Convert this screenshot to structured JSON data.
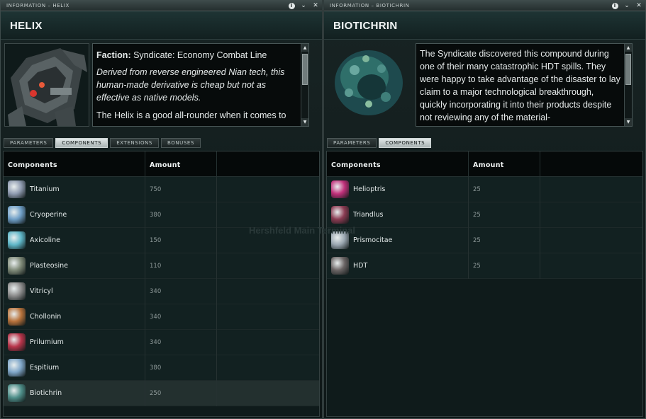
{
  "left": {
    "title": "INFORMATION – HELIX",
    "name": "HELIX",
    "faction_label": "Faction:",
    "faction_value": " Syndicate: Economy Combat Line",
    "description": "Derived from reverse engineered Nian tech, this human-made derivative is cheap but not as effective as native models.",
    "description2": "The Helix is a good all-rounder when it comes to",
    "tabs": [
      "PARAMETERS",
      "COMPONENTS",
      "EXTENSIONS",
      "BONUSES"
    ],
    "columns": [
      "Components",
      "Amount"
    ],
    "rows": [
      {
        "name": "Titanium",
        "amount": "750",
        "icon": "titanium-icon",
        "color": "#8f9bb0"
      },
      {
        "name": "Cryoperine",
        "amount": "380",
        "icon": "cryoperine-icon",
        "color": "#6f9fc7"
      },
      {
        "name": "Axicoline",
        "amount": "150",
        "icon": "axicoline-icon",
        "color": "#5fb7c8"
      },
      {
        "name": "Plasteosine",
        "amount": "110",
        "icon": "plasteosine-icon",
        "color": "#7f8a78"
      },
      {
        "name": "Vitricyl",
        "amount": "340",
        "icon": "vitricyl-icon",
        "color": "#8d8d8d"
      },
      {
        "name": "Chollonin",
        "amount": "340",
        "icon": "chollonin-icon",
        "color": "#b8733c"
      },
      {
        "name": "Prilumium",
        "amount": "340",
        "icon": "prilumium-icon",
        "color": "#b8344a"
      },
      {
        "name": "Espitium",
        "amount": "380",
        "icon": "espitium-icon",
        "color": "#7fa6c8"
      },
      {
        "name": "Biotichrin",
        "amount": "250",
        "icon": "biotichrin-icon",
        "color": "#4f8f8a"
      }
    ]
  },
  "right": {
    "title": "INFORMATION – BIOTICHRIN",
    "name": "BIOTICHRIN",
    "description": "The Syndicate discovered this compound during one of their many catastrophic HDT spills. They were happy to take advantage of the disaster to lay claim to a major technological breakthrough, quickly incorporating it into their products despite not reviewing any of the material-",
    "tabs": [
      "PARAMETERS",
      "COMPONENTS"
    ],
    "columns": [
      "Components",
      "Amount"
    ],
    "rows": [
      {
        "name": "Helioptris",
        "amount": "25",
        "icon": "helioptris-icon",
        "color": "#c0307a"
      },
      {
        "name": "Triandlus",
        "amount": "25",
        "icon": "triandlus-icon",
        "color": "#8a3b52"
      },
      {
        "name": "Prismocitae",
        "amount": "25",
        "icon": "prismocitae-icon",
        "color": "#9aa6b0"
      },
      {
        "name": "HDT",
        "amount": "25",
        "icon": "hdt-icon",
        "color": "#6a6464"
      }
    ]
  },
  "background_text": "Hershfeld Main Terminal"
}
